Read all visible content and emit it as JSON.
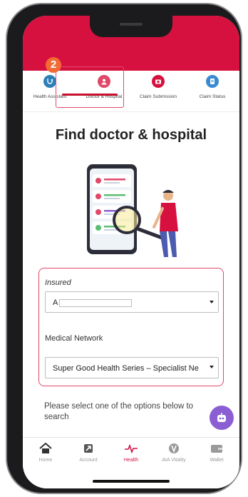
{
  "tabs": [
    {
      "label": "Health Assistant",
      "icon": "stethoscope-icon",
      "color": "#2d7fb8"
    },
    {
      "label": "Doctor & Hospital",
      "icon": "doctor-icon",
      "color": "#e0486a"
    },
    {
      "label": "Claim Submission",
      "icon": "first-aid-icon",
      "color": "#d6113f"
    },
    {
      "label": "Claim Status",
      "icon": "document-icon",
      "color": "#3a8ad0"
    }
  ],
  "step_badge": "2",
  "page_title": "Find doctor & hospital",
  "form": {
    "insured_label": "Insured",
    "insured_value": "A",
    "network_label": "Medical Network",
    "network_value": "Super Good Health Series – Specialist Ne"
  },
  "hint": "Please select one of the options below to search",
  "bottom_nav": [
    {
      "label": "Home",
      "icon": "home-icon"
    },
    {
      "label": "Account",
      "icon": "account-icon"
    },
    {
      "label": "Health",
      "icon": "heartbeat-icon"
    },
    {
      "label": "AIA Vitality",
      "icon": "vitality-icon"
    },
    {
      "label": "Wallet",
      "icon": "wallet-icon"
    }
  ],
  "colors": {
    "brand": "#d6113f",
    "accent_orange": "#f26b35",
    "chat_purple": "#8b5ed3"
  }
}
